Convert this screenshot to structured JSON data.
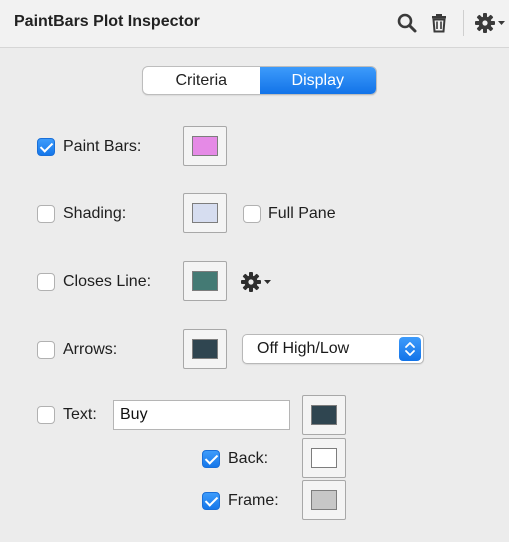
{
  "header": {
    "title": "PaintBars Plot Inspector",
    "icons": [
      "search-icon",
      "trash-icon",
      "gear-menu-icon"
    ]
  },
  "tabs": [
    {
      "label": "Criteria",
      "active": false
    },
    {
      "label": "Display",
      "active": true
    }
  ],
  "rows": {
    "paint_bars": {
      "label": "Paint Bars:",
      "checked": true,
      "color": "#e58ae6"
    },
    "shading": {
      "label": "Shading:",
      "checked": false,
      "color": "#d6ddf0",
      "full_pane": {
        "label": "Full Pane",
        "checked": false
      }
    },
    "closes_line": {
      "label": "Closes Line:",
      "checked": false,
      "color": "#447a74",
      "icon": "gear-menu-icon"
    },
    "arrows": {
      "label": "Arrows:",
      "checked": false,
      "color": "#2f4550",
      "select": {
        "value": "Off High/Low"
      }
    },
    "text": {
      "label": "Text:",
      "checked": false,
      "value": "Buy",
      "color": "#2f4550",
      "back": {
        "label": "Back:",
        "checked": true,
        "color": "#ffffff"
      },
      "frame": {
        "label": "Frame:",
        "checked": true,
        "color": "#c7c7c7"
      }
    }
  },
  "colors": {
    "accent": "#1a7cf0",
    "panel_bg": "#ececec"
  }
}
